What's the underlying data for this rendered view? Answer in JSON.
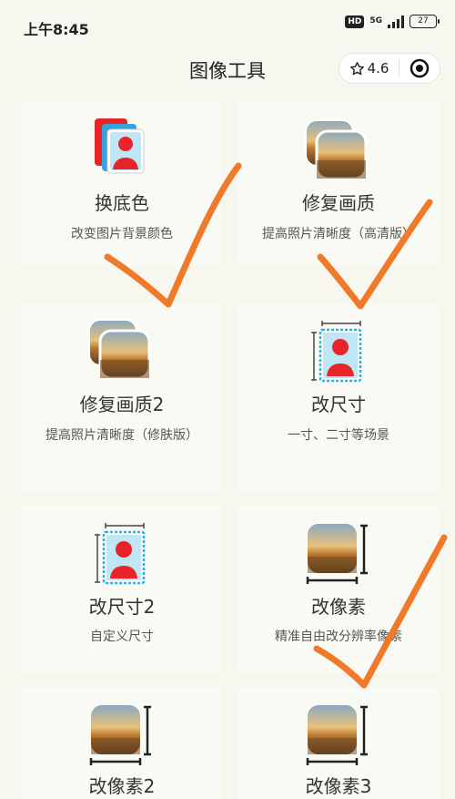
{
  "status": {
    "time": "上午8:45",
    "hd": "HD",
    "network": "5G",
    "battery": "27"
  },
  "nav": {
    "title": "图像工具",
    "rating": "4.6"
  },
  "tools": [
    {
      "title": "换底色",
      "desc": "改变图片背景颜色",
      "icon": "id-photo-background-icon"
    },
    {
      "title": "修复画质",
      "desc": "提高照片清晰度（高清版）",
      "icon": "landscape-photos-icon"
    },
    {
      "title": "修复画质2",
      "desc": "提高照片清晰度（修肤版）",
      "icon": "landscape-photos-icon"
    },
    {
      "title": "改尺寸",
      "desc": "一寸、二寸等场景",
      "icon": "id-photo-resize-icon"
    },
    {
      "title": "改尺寸2",
      "desc": "自定义尺寸",
      "icon": "id-photo-resize-icon"
    },
    {
      "title": "改像素",
      "desc": "精准自由改分辨率像素",
      "icon": "photo-dimension-icon"
    },
    {
      "title": "改像素2",
      "desc": "",
      "icon": "photo-dimension-icon"
    },
    {
      "title": "改像素3",
      "desc": "",
      "icon": "photo-dimension-icon"
    }
  ],
  "colors": {
    "background": "#f7f7ef",
    "annotation_stroke": "#f07a2a",
    "id_red": "#e8232a",
    "id_blue_bg": "#bfe6f5"
  }
}
